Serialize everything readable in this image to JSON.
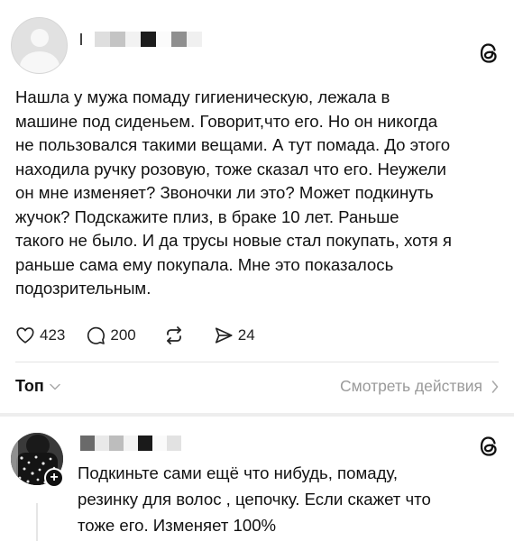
{
  "post": {
    "author_redacted": true,
    "text": "Нашла у мужа помаду гигиеническую, лежала в\nмашине под сиденьем. Говорит,что его. Но он никогда\nне пользовался такими вещами. А тут помада. До этого\nнаходила ручку розовую, тоже сказал что его. Неужели\nон мне изменяет? Звоночки ли это? Может подкинуть\nжучок? Подскажите плиз, в браке 10 лет. Раньше\nтакого не было. И да трусы новые стал покупать, хотя я\nраньше сама ему покупала. Мне это показалось\nподозрительным.",
    "likes": "423",
    "replies": "200",
    "shares": "24",
    "icons": [
      "heart-icon",
      "comment-icon",
      "repost-icon",
      "share-icon",
      "threads-logo-icon"
    ]
  },
  "sort": {
    "label": "Топ",
    "view_actions": "Смотреть действия"
  },
  "comment": {
    "author_redacted": true,
    "text": "Подкиньте сами ещё что нибудь, помаду,\nрезинку для волос , цепочку.  Если скажет что\nтоже его. Изменяет 100%",
    "icons": [
      "plus-icon",
      "threads-logo-icon"
    ]
  },
  "colors": {
    "text": "#111111",
    "muted": "#9a9a9a",
    "divider": "#e3e3e3",
    "separator": "#eeeeee"
  }
}
